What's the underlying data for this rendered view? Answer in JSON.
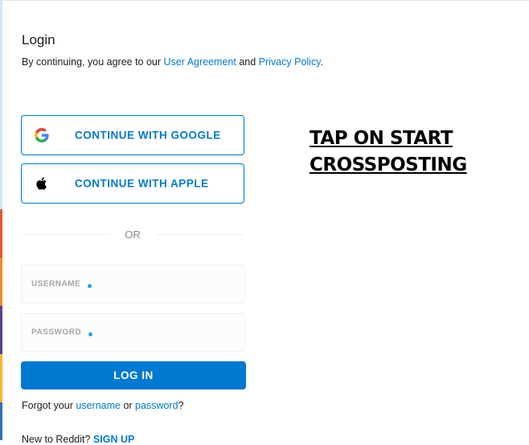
{
  "login": {
    "title": "Login",
    "terms_prefix": "By continuing, you agree to our ",
    "user_agreement": "User Agreement",
    "terms_and": " and ",
    "privacy_policy": "Privacy Policy",
    "terms_suffix": "."
  },
  "oauth": {
    "google_label": "CONTINUE WITH GOOGLE",
    "apple_label": "CONTINUE WITH APPLE",
    "google_icon": "google-icon",
    "apple_icon": "apple-icon"
  },
  "divider": {
    "text": "OR"
  },
  "form": {
    "username_label": "USERNAME",
    "password_label": "PASSWORD",
    "login_button": "LOG IN"
  },
  "forgot": {
    "prefix": "Forgot your ",
    "username": "username",
    "or": " or ",
    "password": "password",
    "suffix": "?"
  },
  "signup": {
    "prefix": "New to Reddit? ",
    "link": "SIGN UP"
  },
  "annotation": {
    "line1": "TAP ON START",
    "line2": "CROSSPOSTING"
  },
  "colors": {
    "accent": "#0079d3",
    "dot": "#24a0ed"
  }
}
